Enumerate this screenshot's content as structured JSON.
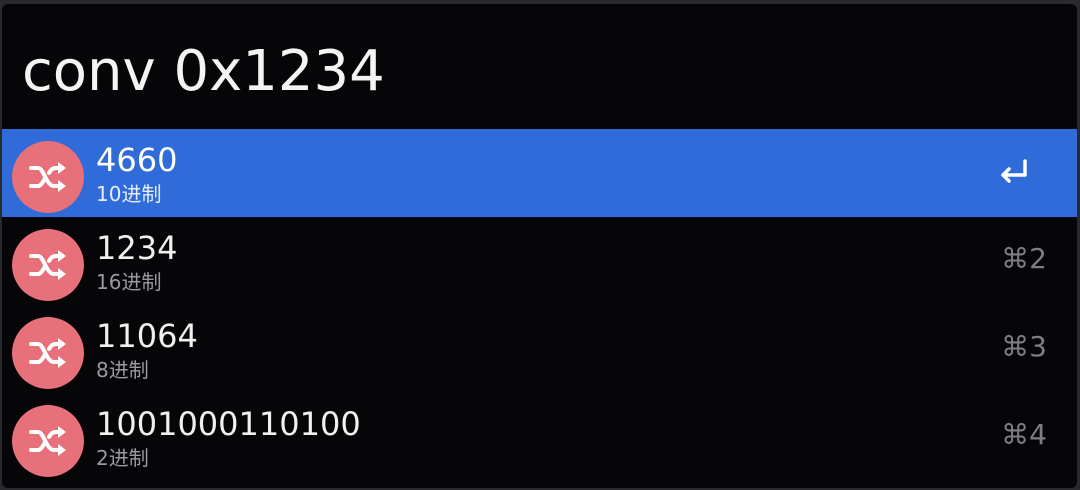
{
  "search": {
    "query": "conv 0x1234"
  },
  "results": [
    {
      "title": "4660",
      "subtitle": "10进制",
      "shortcut": "",
      "selected": true,
      "icon": "shuffle-icon"
    },
    {
      "title": "1234",
      "subtitle": "16进制",
      "shortcut": "⌘2",
      "selected": false,
      "icon": "shuffle-icon"
    },
    {
      "title": "11064",
      "subtitle": "8进制",
      "shortcut": "⌘3",
      "selected": false,
      "icon": "shuffle-icon"
    },
    {
      "title": "1001000110100",
      "subtitle": "2进制",
      "shortcut": "⌘4",
      "selected": false,
      "icon": "shuffle-icon"
    }
  ],
  "colors": {
    "background": "#060609",
    "selection": "#2f6bd9",
    "icon_bg": "#e8707a"
  },
  "selected_action_icon": "return-icon"
}
